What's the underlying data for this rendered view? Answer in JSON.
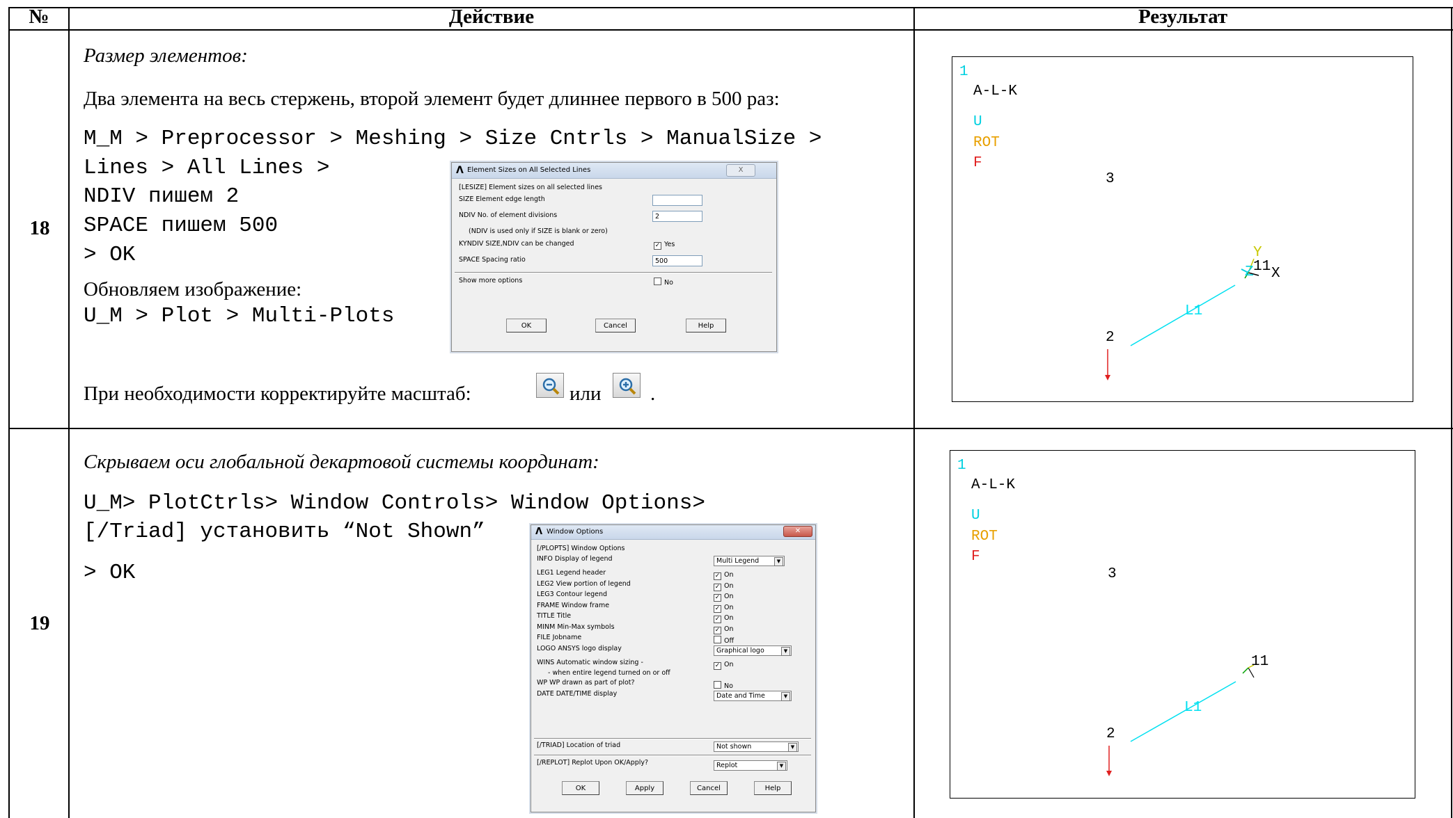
{
  "header": {
    "num": "№",
    "action": "Действие",
    "result": "Результат"
  },
  "rows": [
    {
      "num": "18",
      "italic_title": "Размер элементов:",
      "desc": "Два элемента на весь стержень, второй элемент будет длиннее первого в 500 раз:",
      "code": [
        "M_M > Preprocessor > Meshing > Size Cntrls > ManualSize >",
        "Lines > All Lines >",
        "NDIV пишем 2",
        "SPACE пишем 500",
        "> OK"
      ],
      "update_text": "Обновляем изображение:",
      "update_code": "U_M > Plot > Multi-Plots",
      "zoom_text_before": "При необходимости корректируйте масштаб:",
      "zoom_text_mid": "или",
      "zoom_text_end": ".",
      "dialog": {
        "title": "Element Sizes on All Selected Lines",
        "close": "X",
        "header": "[LESIZE] Element sizes on all selected lines",
        "size_label": "SIZE   Element edge length",
        "size_value": "",
        "ndiv_label": "NDIV   No. of element divisions",
        "ndiv_value": "2",
        "ndiv_note": "(NDIV is used only if SIZE is blank or zero)",
        "kyndiv_label": "KYNDIV  SIZE,NDIV can be changed",
        "kyndiv_value": "Yes",
        "space_label": "SPACE   Spacing ratio",
        "space_value": "500",
        "more_label": "Show more options",
        "more_value": "No",
        "ok": "OK",
        "cancel": "Cancel",
        "help": "Help"
      },
      "plot": {
        "num": "1",
        "title": "A-L-K",
        "u": "U",
        "rot": "ROT",
        "f": "F",
        "n3": "3",
        "n11": "11",
        "nx": "X",
        "ny": "Y",
        "nz": "Z",
        "l1": "L1",
        "n2": "2"
      }
    },
    {
      "num": "19",
      "italic_title": "Скрываем оси глобальной декартовой системы координат:",
      "code": [
        "U_M> PlotCtrls> Window Controls> Window Options>",
        "[/Triad] установить “Not Shown”",
        "> OK"
      ],
      "dialog": {
        "title": "Window Options",
        "header": "[/PLOPTS]  Window Options",
        "items": [
          {
            "label": "INFO   Display of legend",
            "value": "Multi Legend",
            "kind": "select"
          },
          {
            "label": "LEG1   Legend header",
            "value": "On",
            "kind": "check",
            "checked": true
          },
          {
            "label": "LEG2   View portion of legend",
            "value": "On",
            "kind": "check",
            "checked": true
          },
          {
            "label": "LEG3   Contour legend",
            "value": "On",
            "kind": "check",
            "checked": true
          },
          {
            "label": "FRAME  Window frame",
            "value": "On",
            "kind": "check",
            "checked": true
          },
          {
            "label": "TITLE  Title",
            "value": "On",
            "kind": "check",
            "checked": true
          },
          {
            "label": "MINM   Min-Max symbols",
            "value": "On",
            "kind": "check",
            "checked": true
          },
          {
            "label": "FILE   Jobname",
            "value": "Off",
            "kind": "check",
            "checked": false
          },
          {
            "label": "LOGO   ANSYS logo display",
            "value": "Graphical logo",
            "kind": "select"
          },
          {
            "label": "WINS   Automatic window sizing -",
            "value": "On",
            "kind": "check",
            "checked": true
          },
          {
            "label": "- when entire legend turned on or off",
            "value": "",
            "kind": "note"
          },
          {
            "label": "WP   WP drawn as part of plot?",
            "value": "No",
            "kind": "check",
            "checked": false
          },
          {
            "label": "DATE   DATE/TIME display",
            "value": "Date and Time",
            "kind": "select"
          }
        ],
        "triad_label": "[/TRIAD]  Location of triad",
        "triad_value": "Not shown",
        "replot_label": "[/REPLOT]  Replot Upon OK/Apply?",
        "replot_value": "Replot",
        "ok": "OK",
        "apply": "Apply",
        "cancel": "Cancel",
        "help": "Help"
      },
      "plot": {
        "num": "1",
        "title": "A-L-K",
        "u": "U",
        "rot": "ROT",
        "f": "F",
        "n3": "3",
        "n11": "11",
        "l1": "L1",
        "n2": "2"
      }
    }
  ],
  "colors": {
    "cyan": "#00d0e0",
    "orange": "#e8a000",
    "red": "#e02020"
  }
}
